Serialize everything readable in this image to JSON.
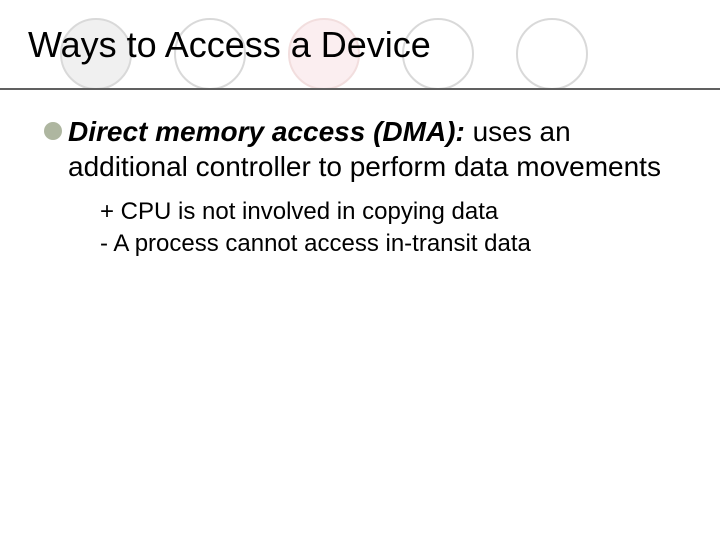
{
  "title": "Ways to Access a Device",
  "bullet": {
    "term": "Direct memory access (DMA):",
    "rest": "  uses an additional controller to perform data movements"
  },
  "sub": {
    "item1": "+ CPU is not involved in copying data",
    "item2": "- A process cannot access in-transit data"
  }
}
